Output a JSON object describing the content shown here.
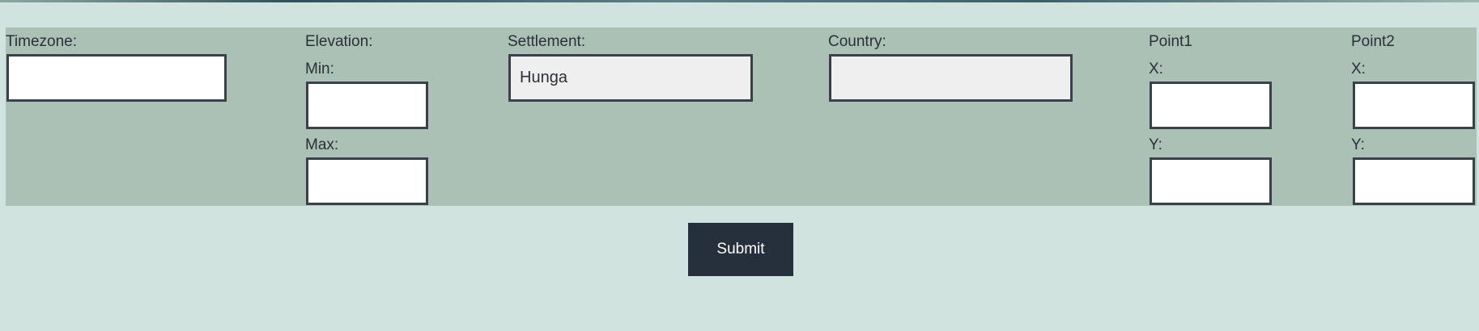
{
  "colors": {
    "page_background": "#d0e3de",
    "panel_background": "#abc1b5",
    "input_border": "#3a414b",
    "readonly_background": "#efefef",
    "button_background": "#262f3c"
  },
  "form": {
    "timezone": {
      "label": "Timezone:",
      "value": ""
    },
    "elevation": {
      "label": "Elevation:",
      "min_label": "Min:",
      "min_value": "",
      "max_label": "Max:",
      "max_value": ""
    },
    "settlement": {
      "label": "Settlement:",
      "value": "Hunga"
    },
    "country": {
      "label": "Country:",
      "value": ""
    },
    "point1": {
      "label": "Point1",
      "x_label": "X:",
      "x_value": "",
      "y_label": "Y:",
      "y_value": ""
    },
    "point2": {
      "label": "Point2",
      "x_label": "X:",
      "x_value": "",
      "y_label": "Y:",
      "y_value": ""
    }
  },
  "submit_label": "Submit"
}
